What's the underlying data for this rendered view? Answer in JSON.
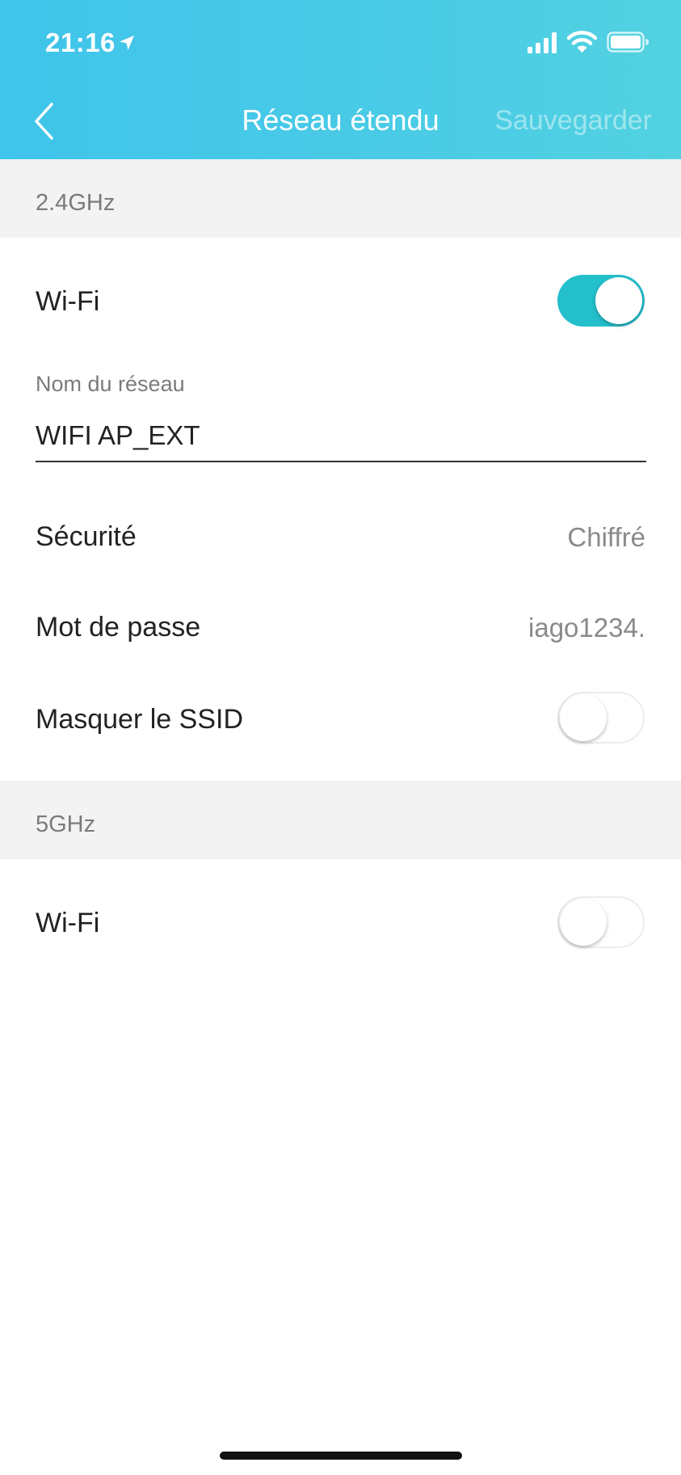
{
  "status_bar": {
    "time": "21:16",
    "icons": [
      "location-arrow-icon",
      "cellular-signal-icon",
      "wifi-signal-icon",
      "battery-icon"
    ]
  },
  "nav": {
    "back_icon": "chevron-left-icon",
    "title": "Réseau étendu",
    "save_label": "Sauvegarder"
  },
  "band_24": {
    "header": "2.4GHz",
    "wifi": {
      "label": "Wi-Fi",
      "enabled": true
    },
    "network_name": {
      "label": "Nom du réseau",
      "value": "WIFI AP_EXT"
    },
    "security": {
      "label": "Sécurité",
      "value": "Chiffré"
    },
    "password": {
      "label": "Mot de passe",
      "value": "iago1234."
    },
    "hide_ssid": {
      "label": "Masquer le SSID",
      "enabled": false
    }
  },
  "band_5": {
    "header": "5GHz",
    "wifi": {
      "label": "Wi-Fi",
      "enabled": false
    }
  },
  "colors": {
    "header_gradient_start": "#3fc4ea",
    "header_gradient_end": "#52d2e0",
    "toggle_on": "#23bfcb",
    "section_bg": "#f3f3f3"
  }
}
